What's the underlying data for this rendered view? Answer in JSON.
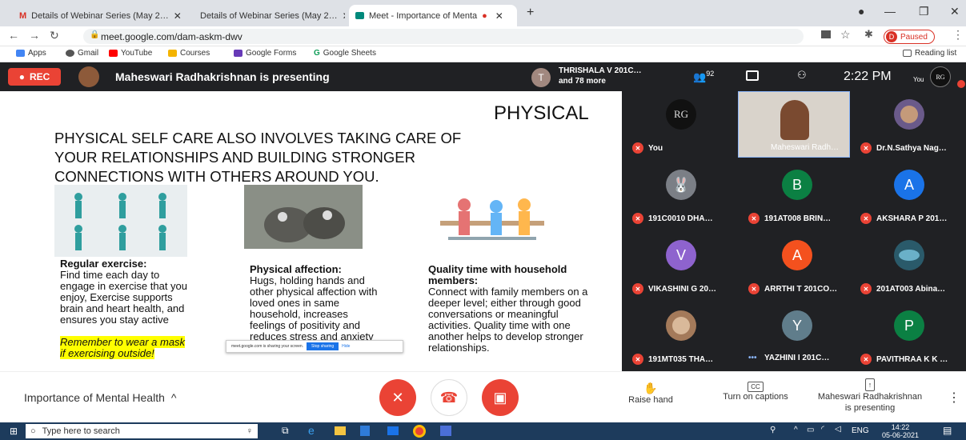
{
  "tabs": [
    {
      "label": "Details of Webinar Series (May 2…"
    },
    {
      "label": "Details of Webinar Series (May 2…"
    },
    {
      "label": "Meet - Importance of Menta"
    }
  ],
  "address": {
    "url": "meet.google.com/dam-askm-dwv",
    "profile_initial": "D",
    "profile_status": "Paused"
  },
  "bookmarks": [
    "Apps",
    "Gmail",
    "YouTube",
    "Courses",
    "Google Forms",
    "Google Sheets"
  ],
  "reading_list": "Reading list",
  "meet": {
    "rec": "REC",
    "presenting_text": "Maheswari Radhakrishnan is presenting",
    "participant_top": "THRISHALA V 201C…",
    "participant_more": "and 78 more",
    "participant_initial": "T",
    "people_count": "92",
    "time": "2:22 PM",
    "you_label": "You",
    "you_initials": "RG"
  },
  "slide": {
    "heading": "PHYSICAL",
    "intro": [
      "PHYSICAL SELF CARE ALSO INVOLVES TAKING CARE OF",
      "YOUR RELATIONSHIPS AND BUILDING STRONGER",
      "CONNECTIONS WITH OTHERS AROUND YOU."
    ],
    "col1_title": "Regular exercise:",
    "col1_body": [
      "Find time each day to",
      "engage in exercise that you",
      "enjoy, Exercise supports",
      "brain and heart health, and",
      "ensures you stay active"
    ],
    "col1_note": [
      "Remember to  wear a mask",
      "if exercising outside!"
    ],
    "col2_title": "Physical affection:",
    "col2_body": [
      "Hugs, holding hands and",
      "other physical affection with",
      "loved ones in same",
      "household,  increases",
      "feelings of positivity and",
      "reduces stress and anxiety"
    ],
    "col3_title": [
      "Quality time with household",
      "members:"
    ],
    "col3_body": [
      "Connect with family members on a",
      "deeper level;  either through good",
      "conversations or meaningful",
      "activities. Quality time with one",
      "another helps to develop stronger",
      "relationships."
    ],
    "share_text": "meet.google.com is sharing your screen.",
    "stop_label": "Stop sharing",
    "hide_label": "Hide"
  },
  "participants": [
    {
      "name": "You",
      "initial": "RG",
      "color": "#111111"
    },
    {
      "name": "Maheswari Radh…",
      "initial": "",
      "color": "#cfc8c0"
    },
    {
      "name": "Dr.N.Sathya Nag…",
      "initial": "",
      "color": "#6a5a8a"
    },
    {
      "name": "191C0010 DHA…",
      "initial": "",
      "color": "#7b7f86"
    },
    {
      "name": "191AT008 BRIN…",
      "initial": "B",
      "color": "#0b8043"
    },
    {
      "name": "AKSHARA P 201…",
      "initial": "A",
      "color": "#1a73e8"
    },
    {
      "name": "VIKASHINI G 20…",
      "initial": "V",
      "color": "#8e63ce"
    },
    {
      "name": "ARRTHI T 201CO…",
      "initial": "A",
      "color": "#f4511e"
    },
    {
      "name": "201AT003 Abina…",
      "initial": "",
      "color": "#2a5a6a"
    },
    {
      "name": "191MT035 THA…",
      "initial": "",
      "color": "#a47a5a"
    },
    {
      "name": "YAZHINI I 201C…",
      "initial": "Y",
      "color": "#607d8b"
    },
    {
      "name": "PAVITHRAA K K …",
      "initial": "P",
      "color": "#0b8043"
    }
  ],
  "bottom": {
    "meeting_title": "Importance of Mental Health",
    "raise_hand": "Raise hand",
    "captions": "Turn on captions",
    "presenter": [
      "Maheswari Radhakrishnan",
      "is presenting"
    ]
  },
  "taskbar": {
    "search": "Type here to search",
    "lang": "ENG",
    "time": "14:22",
    "date": "05-06-2021"
  },
  "colors": {
    "meet_bg": "#202124",
    "danger": "#ea4335",
    "taskbar": "#1d3b5c",
    "highlight": "#ffff00"
  }
}
